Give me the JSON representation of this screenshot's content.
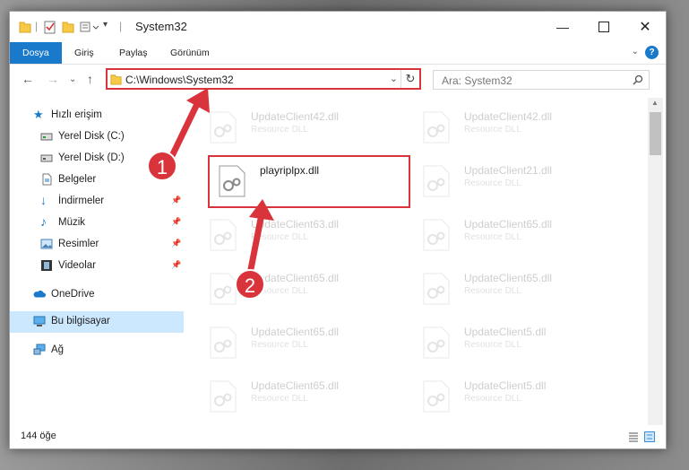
{
  "window": {
    "title": "System32"
  },
  "ribbon": {
    "tabs": [
      "Dosya",
      "Giriş",
      "Paylaş",
      "Görünüm"
    ],
    "help": "?"
  },
  "navigation": {
    "address": "C:\\Windows\\System32",
    "search_placeholder": "Ara: System32"
  },
  "sidebar": {
    "items": [
      {
        "label": "Hızlı erişim",
        "icon": "star-icon"
      },
      {
        "label": "Yerel Disk (C:)",
        "icon": "drive-icon"
      },
      {
        "label": "Yerel Disk (D:)",
        "icon": "drive-icon"
      },
      {
        "label": "Belgeler",
        "icon": "documents-icon"
      },
      {
        "label": "İndirmeler",
        "icon": "download-icon"
      },
      {
        "label": "Müzik",
        "icon": "music-icon"
      },
      {
        "label": "Resimler",
        "icon": "pictures-icon"
      },
      {
        "label": "Videolar",
        "icon": "videos-icon"
      },
      {
        "label": "OneDrive",
        "icon": "cloud-icon"
      },
      {
        "label": "Bu bilgisayar",
        "icon": "computer-icon"
      },
      {
        "label": "Ağ",
        "icon": "network-icon"
      }
    ]
  },
  "files": [
    {
      "name": "UpdateClient42.dll",
      "type": "Resource DLL"
    },
    {
      "name": "UpdateClient42.dll",
      "type": "Resource DLL"
    },
    {
      "name": "playriplpx.dll",
      "type": ""
    },
    {
      "name": "UpdateClient21.dll",
      "type": "Resource DLL"
    },
    {
      "name": "UpdateClient63.dll",
      "type": "Resource DLL"
    },
    {
      "name": "UpdateClient65.dll",
      "type": "Resource DLL"
    },
    {
      "name": "UpdateClient65.dll",
      "type": "Resource DLL"
    },
    {
      "name": "UpdateClient65.dll",
      "type": "Resource DLL"
    },
    {
      "name": "UpdateClient65.dll",
      "type": "Resource DLL"
    },
    {
      "name": "UpdateClient5.dll",
      "type": "Resource DLL"
    },
    {
      "name": "UpdateClient65.dll",
      "type": "Resource DLL"
    },
    {
      "name": "UpdateClient5.dll",
      "type": "Resource DLL"
    }
  ],
  "status": {
    "count": "144 öğe"
  },
  "annotations": {
    "step1": "1",
    "step2": "2"
  },
  "colors": {
    "accent": "#1979ca",
    "highlight": "#d9343c"
  }
}
